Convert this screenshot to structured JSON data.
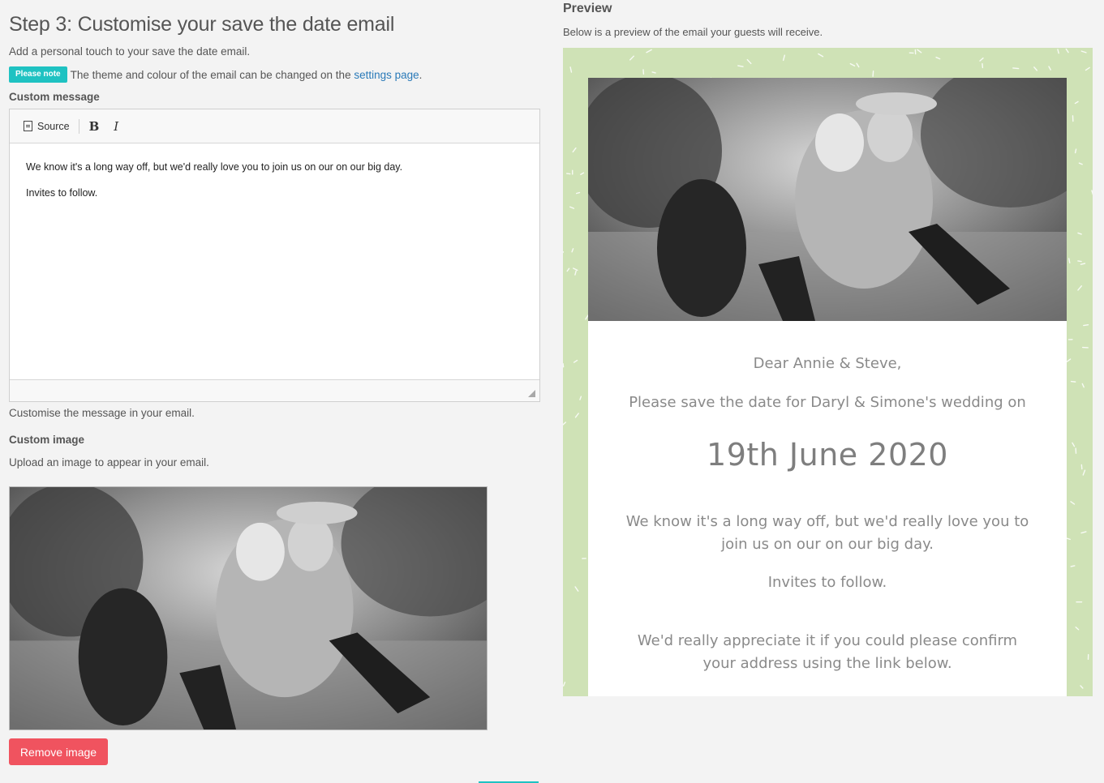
{
  "step": {
    "title": "Step 3: Customise your save the date email",
    "subtitle": "Add a personal touch to your save the date email.",
    "note_badge": "Please note",
    "note_text": "The theme and colour of the email can be changed on the",
    "note_link": "settings page",
    "note_end": "."
  },
  "custom_message": {
    "label": "Custom message",
    "toolbar": {
      "source_label": "Source",
      "bold_label": "B",
      "italic_label": "I"
    },
    "paragraphs": [
      "We know it's a long way off, but we'd really love you to join us on our on our big day.",
      "Invites to follow."
    ],
    "help": "Customise the message in your email."
  },
  "custom_image": {
    "label": "Custom image",
    "help": "Upload an image to appear in your email.",
    "remove_label": "Remove image"
  },
  "preview": {
    "title": "Preview",
    "subtitle": "Below is a preview of the email your guests will receive.",
    "greeting": "Dear Annie & Steve,",
    "intro": "Please save the date for Daryl & Simone's wedding on",
    "date": "19th June 2020",
    "message": "We know it's a long way off, but we'd really love you to join us on our on our big day.",
    "message2": "Invites to follow.",
    "confirm": "We'd really appreciate it if you could please confirm your address using the link below."
  },
  "colors": {
    "accent": "#1fc2c2",
    "danger": "#f0535f",
    "link": "#2a7ab8",
    "frame": "#cfe2b6"
  }
}
